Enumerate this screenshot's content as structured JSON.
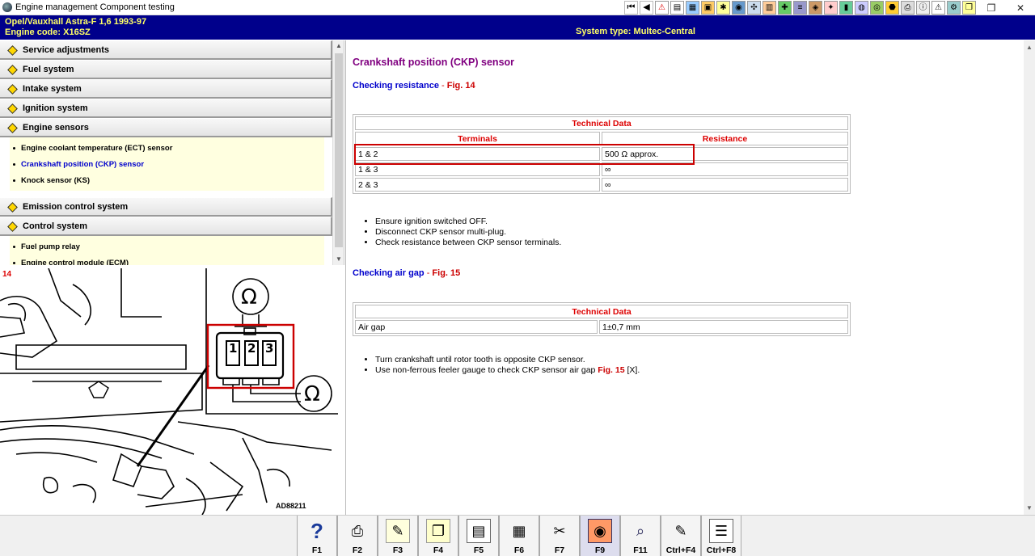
{
  "window": {
    "title": "Engine management Component testing"
  },
  "toolbar": {
    "buttons": [
      "first-page-icon",
      "prev-page-icon",
      "warning-icon",
      "doc-icon",
      "image-icon",
      "folder-icon",
      "settings-icon",
      "gauge-icon",
      "diagram-icon",
      "chart-icon",
      "tools-icon",
      "wiring-icon",
      "car-icon",
      "repair-icon",
      "battery-icon",
      "engine-icon",
      "sensor-icon",
      "fuel-icon",
      "print-icon",
      "info-icon",
      "light-icon",
      "settings-2-icon",
      "copy-icon"
    ]
  },
  "header": {
    "vehicle": "Opel/Vauxhall   Astra-F  1,6  1993-97",
    "engine": "Engine code: X16SZ",
    "system": "System type: Multec-Central"
  },
  "nav": {
    "categories": [
      {
        "label": "Service adjustments"
      },
      {
        "label": "Fuel system"
      },
      {
        "label": "Intake system"
      },
      {
        "label": "Ignition system"
      },
      {
        "label": "Engine sensors"
      },
      {
        "label": "Emission control system"
      },
      {
        "label": "Control system"
      }
    ],
    "engine_sensors_items": [
      "Engine coolant temperature (ECT) sensor",
      "Crankshaft position (CKP) sensor",
      "Knock sensor (KS)"
    ],
    "control_system_items": [
      "Fuel pump relay",
      "Engine control module (ECM)"
    ]
  },
  "figure": {
    "number": "14",
    "code": "AD88211",
    "pins": [
      "1",
      "2",
      "3"
    ],
    "ohm_symbol": "Ω"
  },
  "content": {
    "title": "Crankshaft position (CKP) sensor",
    "section1": {
      "heading": "Checking resistance",
      "sep": " - ",
      "fig": "Fig. 14",
      "table": {
        "caption": "Technical Data",
        "col1": "Terminals",
        "col2": "Resistance",
        "rows": [
          {
            "terminals": "1 & 2",
            "resistance": "500 Ω approx."
          },
          {
            "terminals": "1 & 3",
            "resistance": "∞"
          },
          {
            "terminals": "2 & 3",
            "resistance": "∞"
          }
        ]
      },
      "steps": [
        "Ensure ignition switched OFF.",
        "Disconnect CKP sensor multi-plug.",
        "Check resistance between CKP sensor terminals."
      ]
    },
    "section2": {
      "heading": "Checking air gap",
      "sep": " - ",
      "fig": "Fig. 15",
      "table": {
        "caption": "Technical Data",
        "rows": [
          {
            "label": "Air gap",
            "value": "1±0,7 mm"
          }
        ]
      },
      "steps": [
        "Turn crankshaft until rotor tooth is opposite CKP sensor.",
        "Use non-ferrous feeler gauge to check CKP sensor air gap "
      ],
      "step2_fig": "Fig. 15",
      "step2_suffix": " [X]."
    }
  },
  "fkeys": [
    {
      "label": "F1",
      "icon": "help-icon"
    },
    {
      "label": "F2",
      "icon": "print-icon"
    },
    {
      "label": "F3",
      "icon": "notes-icon"
    },
    {
      "label": "F4",
      "icon": "notes-view-icon"
    },
    {
      "label": "F5",
      "icon": "document-icon"
    },
    {
      "label": "F6",
      "icon": "tables-icon"
    },
    {
      "label": "F7",
      "icon": "bookmark-icon"
    },
    {
      "label": "F9",
      "icon": "sensor-location-icon"
    },
    {
      "label": "F11",
      "icon": "search-icon"
    },
    {
      "label": "Ctrl+F4",
      "icon": "edit-notes-icon"
    },
    {
      "label": "Ctrl+F8",
      "icon": "list-icon"
    }
  ]
}
